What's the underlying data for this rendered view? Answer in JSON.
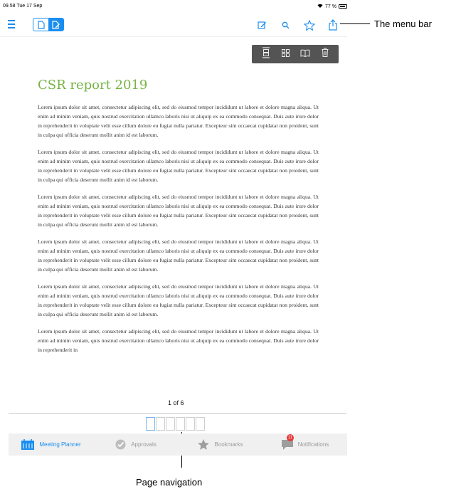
{
  "status_bar": {
    "time": "09.58  Tue 17 Sep",
    "battery": "77 %"
  },
  "app_bar": {
    "icons": [
      "menu-icon",
      "page-view-icon",
      "edit-view-icon",
      "edit-icon",
      "search-icon",
      "star-icon",
      "share-icon"
    ]
  },
  "callouts": {
    "menu_bar": "The menu bar",
    "page_navigation": "Page navigation"
  },
  "page_tools": [
    "page-layout-icon",
    "grid-icon",
    "book-icon",
    "trash-icon"
  ],
  "document": {
    "title": "CSR report 2019",
    "paragraphs": [
      "Lorem ipsum dolor sit amet, consectetur adipiscing elit, sed do eiusmod tempor incididunt ut labore et dolore magna aliqua. Ut enim ad minim veniam, quis nostrud exercitation ullamco laboris nisi ut aliquip ex ea commodo consequat. Duis aute irure dolor in reprehenderit in voluptate velit esse cillum dolore eu fugiat nulla pariatur. Excepteur sint occaecat cupidatat non proident, sunt in culpa qui officia deserunt mollit anim id est laborum.",
      "Lorem ipsum dolor sit amet, consectetur adipiscing elit, sed do eiusmod tempor incididunt ut labore et dolore magna aliqua. Ut enim ad minim veniam, quis nostrud exercitation ullamco laboris nisi ut aliquip ex ea commodo consequat. Duis aute irure dolor in reprehenderit in voluptate velit esse cillum dolore eu fugiat nulla pariatur. Excepteur sint occaecat cupidatat non proident, sunt in culpa qui officia deserunt mollit anim id est laborum.",
      "Lorem ipsum dolor sit amet, consectetur adipiscing elit, sed do eiusmod tempor incididunt ut labore et dolore magna aliqua. Ut enim ad minim veniam, quis nostrud exercitation ullamco laboris nisi ut aliquip ex ea commodo consequat. Duis aute irure dolor in reprehenderit in voluptate velit esse cillum dolore eu fugiat nulla pariatur. Excepteur sint occaecat cupidatat non proident, sunt in culpa qui officia deserunt mollit anim id est laborum.",
      "Lorem ipsum dolor sit amet, consectetur adipiscing elit, sed do eiusmod tempor incididunt ut labore et dolore magna aliqua. Ut enim ad minim veniam, quis nostrud exercitation ullamco laboris nisi ut aliquip ex ea commodo consequat. Duis aute irure dolor in reprehenderit in voluptate velit esse cillum dolore eu fugiat nulla pariatur. Excepteur sint occaecat cupidatat non proident, sunt in culpa qui officia deserunt mollit anim id est laborum.",
      "Lorem ipsum dolor sit amet, consectetur adipiscing elit, sed do eiusmod tempor incididunt ut labore et dolore magna aliqua. Ut enim ad minim veniam, quis nostrud exercitation ullamco laboris nisi ut aliquip ex ea commodo consequat. Duis aute irure dolor in reprehenderit in voluptate velit esse cillum dolore eu fugiat nulla pariatur. Excepteur sint occaecat cupidatat non proident, sunt in culpa qui officia deserunt mollit anim id est laborum.",
      "Lorem ipsum dolor sit amet, consectetur adipiscing elit, sed do eiusmod tempor incididunt ut labore et dolore magna aliqua. Ut enim ad minim veniam, quis nostrud exercitation ullamco laboris nisi ut aliquip ex ea commodo consequat. Duis aute irure dolor in reprehenderit in"
    ]
  },
  "page_nav": {
    "indicator": "1 of 6",
    "current_page": 1,
    "total_pages": 6
  },
  "tab_bar": {
    "tabs": [
      {
        "label": "Meeting Planner",
        "icon": "calendar-icon",
        "active": true
      },
      {
        "label": "Approvals",
        "icon": "check-circle-icon",
        "active": false
      },
      {
        "label": "Bookmarks",
        "icon": "star-icon",
        "active": false
      },
      {
        "label": "Notifications",
        "icon": "chat-bubble-icon",
        "active": false,
        "badge": "11"
      }
    ]
  },
  "colors": {
    "accent": "#1a8ef0",
    "title_green": "#76b445",
    "toolbar_dark": "#545454",
    "badge_red": "#e53935"
  }
}
